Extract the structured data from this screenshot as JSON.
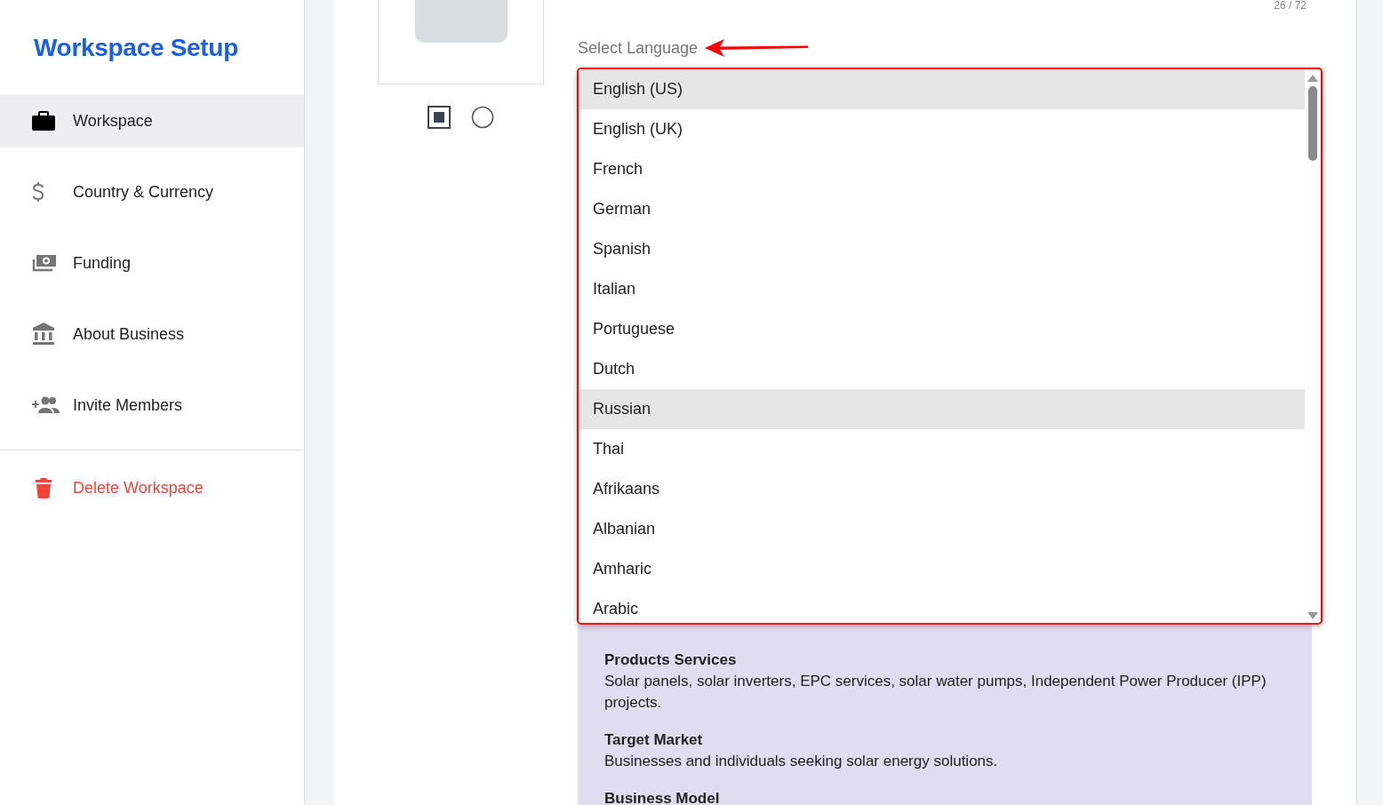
{
  "sidebar": {
    "title": "Workspace Setup",
    "items": [
      {
        "label": "Workspace",
        "selected": true
      },
      {
        "label": "Country & Currency",
        "selected": false
      },
      {
        "label": "Funding",
        "selected": false
      },
      {
        "label": "About Business",
        "selected": false
      },
      {
        "label": "Invite Members",
        "selected": false
      }
    ],
    "delete_action": {
      "label": "Delete Workspace"
    }
  },
  "counter": "26 / 72",
  "language_select": {
    "label": "Select Language",
    "options": [
      {
        "label": "English (US)",
        "highlighted": true
      },
      {
        "label": "English (UK)",
        "highlighted": false
      },
      {
        "label": "French",
        "highlighted": false
      },
      {
        "label": "German",
        "highlighted": false
      },
      {
        "label": "Spanish",
        "highlighted": false
      },
      {
        "label": "Italian",
        "highlighted": false
      },
      {
        "label": "Portuguese",
        "highlighted": false
      },
      {
        "label": "Dutch",
        "highlighted": false
      },
      {
        "label": "Russian",
        "highlighted": true
      },
      {
        "label": "Thai",
        "highlighted": false
      },
      {
        "label": "Afrikaans",
        "highlighted": false
      },
      {
        "label": "Albanian",
        "highlighted": false
      },
      {
        "label": "Amharic",
        "highlighted": false
      },
      {
        "label": "Arabic",
        "highlighted": false
      }
    ]
  },
  "business_summary": [
    {
      "heading": "Products Services",
      "text": "Solar panels, solar inverters, EPC services, solar water pumps, Independent Power Producer (IPP) projects."
    },
    {
      "heading": "Target Market",
      "text": "Businesses and individuals seeking solar energy solutions."
    },
    {
      "heading": "Business Model"
    }
  ]
}
